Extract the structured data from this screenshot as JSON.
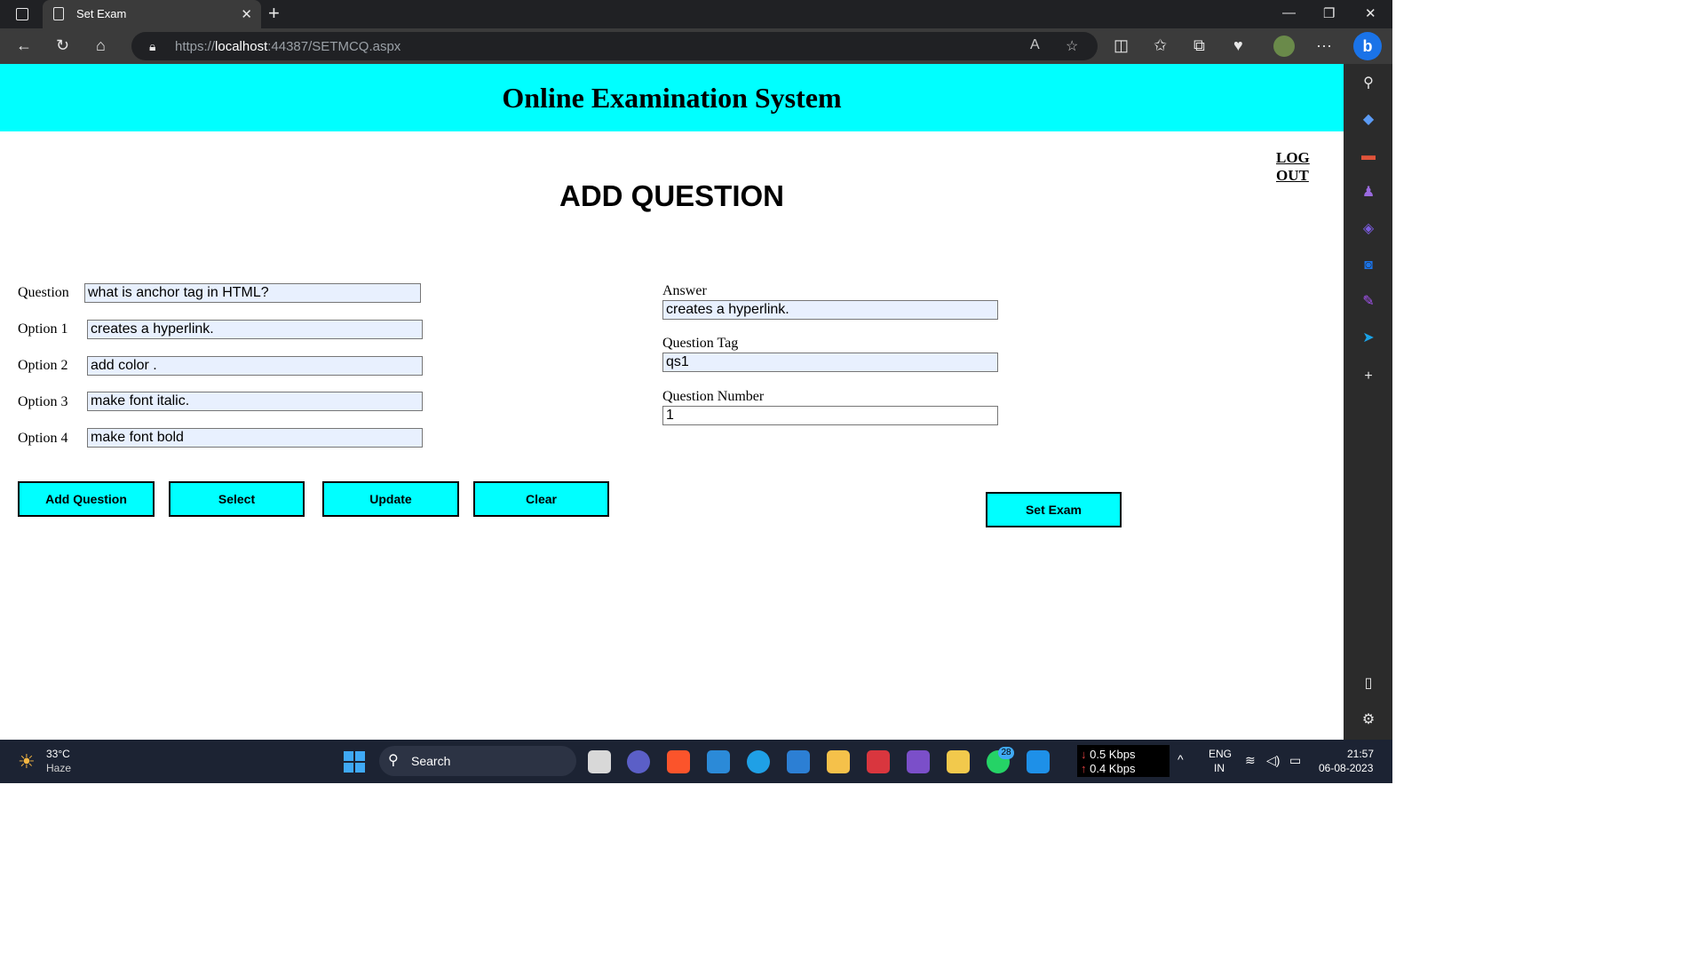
{
  "browser": {
    "tab_title": "Set Exam",
    "tab_close": "✕",
    "new_tab": "+",
    "url_scheme": "https://",
    "url_host": "localhost",
    "url_rest": ":44387/SETMCQ.aspx",
    "menu_dots": "···"
  },
  "page": {
    "banner_title": "Online Examination System",
    "logout_label": "LOG OUT",
    "heading": "ADD QUESTION",
    "left_form": {
      "question_label": "Question",
      "question_value": "what is anchor tag in HTML?",
      "option1_label": "Option 1",
      "option1_value": "creates a hyperlink.",
      "option2_label": "Option 2",
      "option2_value": "add color .",
      "option3_label": "Option 3",
      "option3_value": "make font italic.",
      "option4_label": "Option 4",
      "option4_value": "make font bold"
    },
    "right_form": {
      "answer_label": "Answer",
      "answer_value": "creates a hyperlink.",
      "tag_label": "Question Tag",
      "tag_value": "qs1",
      "number_label": "Question Number",
      "number_value": "1"
    },
    "buttons": {
      "add": "Add Question",
      "select": "Select",
      "update": "Update",
      "clear": "Clear",
      "set_exam": "Set Exam"
    }
  },
  "taskbar": {
    "weather_temp": "33°C",
    "weather_desc": "Haze",
    "search_label": "Search",
    "net_down": "0.5 Kbps",
    "net_up": "0.4 Kbps",
    "lang_top": "ENG",
    "lang_bottom": "IN",
    "time": "21:57",
    "date": "06-08-2023",
    "whatsapp_badge": "28"
  },
  "colors": {
    "banner": "#00ffff",
    "button": "#00ffff",
    "field_fill": "#e8f0fe"
  }
}
